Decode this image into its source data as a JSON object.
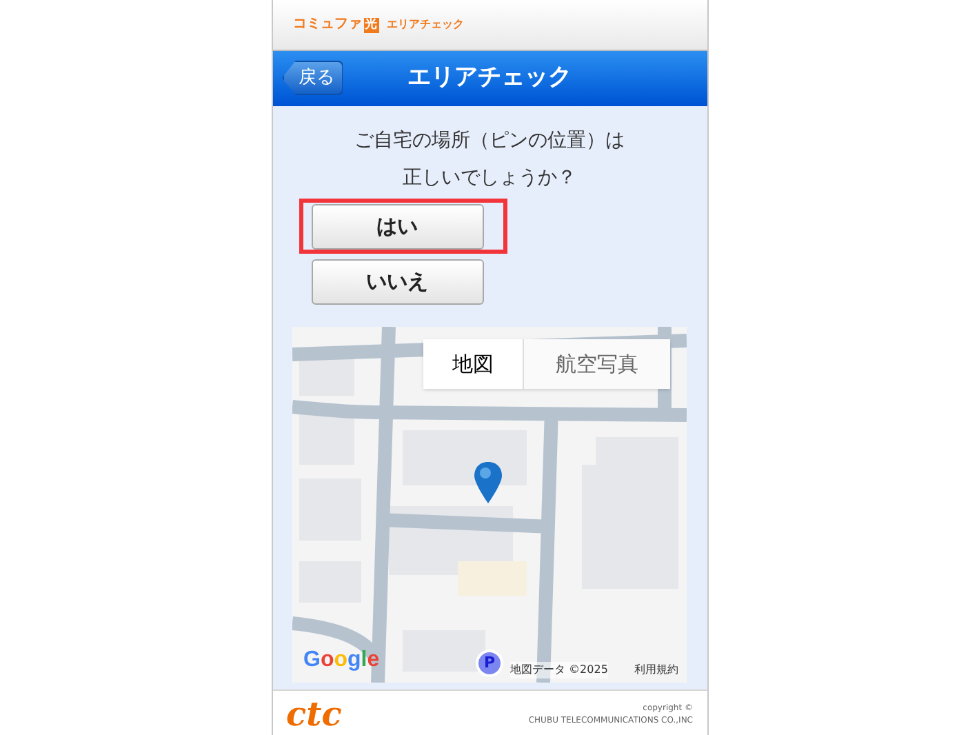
{
  "header": {
    "brand": "コミュファ",
    "brand_badge": "光",
    "app_name": "エリアチェック"
  },
  "nav": {
    "back": "戻る",
    "title": "エリアチェック"
  },
  "question": [
    "ご自宅の場所（ピンの位置）は",
    "正しいでしょうか？"
  ],
  "buttons": [
    {
      "label": "はい",
      "highlighted": true
    },
    {
      "label": "いいえ",
      "highlighted": false
    }
  ],
  "map": {
    "tabs": [
      {
        "label": "地図",
        "selected": true
      },
      {
        "label": "航空写真",
        "selected": false
      }
    ],
    "logo": "Google",
    "parking": "P",
    "attribution": "地図データ ©2025",
    "terms": "利用規約"
  },
  "footer": {
    "logo": "ctc",
    "copyright": "copyright ©",
    "company": "CHUBU TELECOMMUNICATIONS CO.,INC"
  }
}
